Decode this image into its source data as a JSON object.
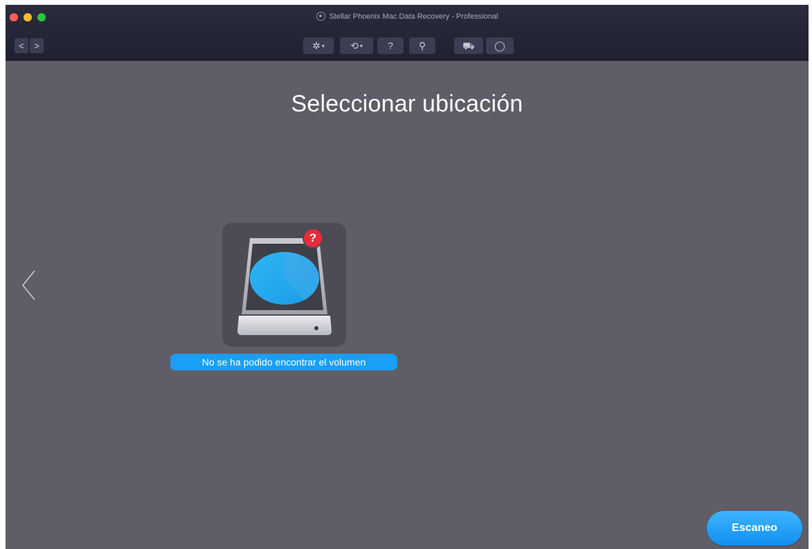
{
  "window": {
    "title": "Stellar Phoenix Mac Data Recovery - Professional"
  },
  "navigation": {
    "back_label": "<",
    "forward_label": ">"
  },
  "toolbar": {
    "items": [
      {
        "icon": "gear-icon",
        "glyph": "✲",
        "has_dropdown": true
      },
      {
        "icon": "history-icon",
        "glyph": "⟲",
        "has_dropdown": true
      },
      {
        "icon": "help-icon",
        "glyph": "?"
      },
      {
        "icon": "scan-disk-icon",
        "glyph": "⚲"
      },
      {
        "icon": "cart-icon",
        "glyph": "⛟"
      },
      {
        "icon": "user-icon",
        "glyph": "◯"
      }
    ],
    "dropdown_glyph": "▾"
  },
  "main": {
    "heading": "Seleccionar ubicación",
    "left_arrow_glyph": "‹",
    "volumes": [
      {
        "label": "No se ha podido encontrar el volumen",
        "status_badge": "?",
        "icon": "hard-drive-icon",
        "status": "not-found"
      }
    ],
    "scan_button_label": "Escaneo"
  },
  "colors": {
    "titlebar": "#23263a",
    "background": "#5f5e68",
    "accent": "#199ff5",
    "badge": "#ea2c3a"
  }
}
